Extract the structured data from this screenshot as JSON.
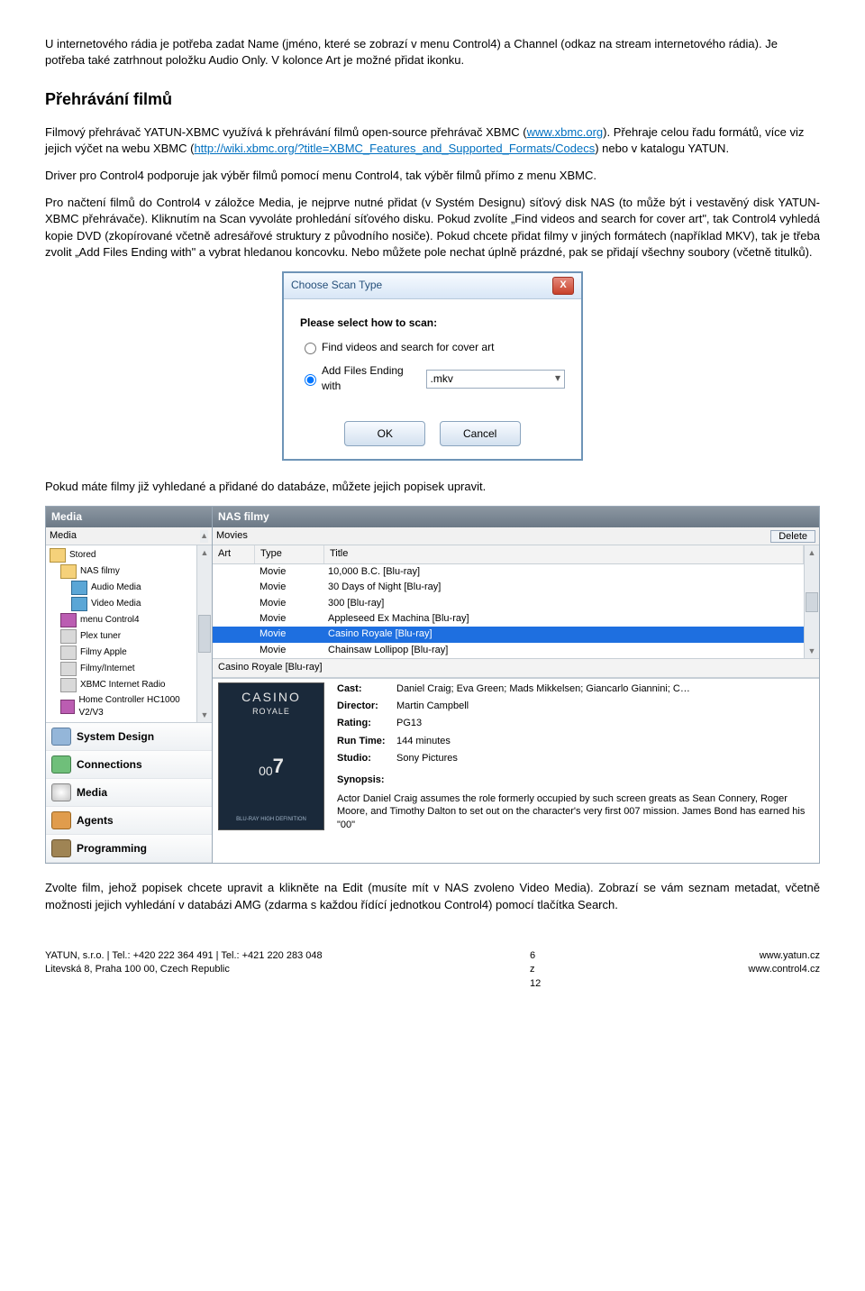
{
  "intro_para": "U internetového rádia je potřeba zadat Name (jméno, které se zobrazí v menu Control4) a Channel (odkaz na stream internetového rádia). Je potřeba také zatrhnout položku Audio Only. V kolonce Art je možné přidat ikonku.",
  "heading": "Přehrávání filmů",
  "para2a": "Filmový přehrávač YATUN-XBMC využívá k přehrávání filmů open-source přehrávač XBMC (",
  "link1": "www.xbmc.org",
  "para2b": "). Přehraje celou řadu formátů, více viz jejich výčet na webu XBMC (",
  "link2": "http://wiki.xbmc.org/?title=XBMC_Features_and_Supported_Formats/Codecs",
  "para2c": ") nebo v katalogu YATUN.",
  "para3": "Driver pro Control4 podporuje jak výběr filmů pomocí menu Control4, tak výběr filmů přímo z menu XBMC.",
  "para4": "Pro načtení filmů do Control4 v záložce Media, je nejprve nutné přidat (v Systém Designu) síťový disk NAS (to může být i vestavěný disk YATUN-XBMC přehrávače). Kliknutím na Scan vyvoláte prohledání síťového disku. Pokud zvolíte „Find videos and search for cover art\", tak Control4 vyhledá kopie DVD (zkopírované včetně adresářové struktury z původního nosiče). Pokud chcete přidat filmy v jiných formátech (například MKV), tak je třeba zvolit „Add Files Ending with\" a vybrat hledanou koncovku. Nebo můžete pole nechat úplně prázdné, pak se přidají všechny soubory (včetně titulků).",
  "dialog": {
    "title": "Choose Scan Type",
    "prompt": "Please select how to scan:",
    "opt1": "Find videos and search for cover art",
    "opt2": "Add Files Ending with",
    "combo_value": ".mkv",
    "ok": "OK",
    "cancel": "Cancel"
  },
  "para5": "Pokud máte filmy již vyhledané a přidané do databáze, můžete jejich popisek upravit.",
  "media": {
    "tree_header": "Media",
    "right_header": "NAS filmy",
    "sub_left": "Media",
    "sub_right": "Movies",
    "delete": "Delete",
    "stored": "Stored",
    "tree_items": [
      "NAS filmy",
      "Audio Media",
      "Video Media",
      "menu Control4",
      "Plex tuner",
      "Filmy Apple",
      "Filmy/Internet",
      "XBMC Internet Radio",
      "Home Controller HC1000 V2/V3"
    ],
    "nav": [
      "System Design",
      "Connections",
      "Media",
      "Agents",
      "Programming"
    ],
    "cols": {
      "art": "Art",
      "type": "Type",
      "title": "Title"
    },
    "rows": [
      {
        "type": "Movie",
        "title": "10,000 B.C. [Blu-ray]"
      },
      {
        "type": "Movie",
        "title": "30 Days of Night [Blu-ray]"
      },
      {
        "type": "Movie",
        "title": "300 [Blu-ray]"
      },
      {
        "type": "Movie",
        "title": "Appleseed Ex Machina [Blu-ray]"
      },
      {
        "type": "Movie",
        "title": "Casino Royale [Blu-ray]",
        "selected": true
      },
      {
        "type": "Movie",
        "title": "Chainsaw Lollipop [Blu-ray]"
      }
    ],
    "detail": {
      "title": "Casino Royale [Blu-ray]",
      "cover_big": "CASINO",
      "cover_sub": "ROYALE",
      "cover_seven": "7",
      "cast_label": "Cast:",
      "cast": "Daniel Craig; Eva Green; Mads Mikkelsen; Giancarlo Giannini; C…",
      "director_label": "Director:",
      "director": "Martin Campbell",
      "rating_label": "Rating:",
      "rating": "PG13",
      "runtime_label": "Run Time:",
      "runtime": "144 minutes",
      "studio_label": "Studio:",
      "studio": "Sony Pictures",
      "synopsis_label": "Synopsis:",
      "synopsis": "Actor Daniel Craig assumes the role formerly occupied by such screen greats as Sean Connery, Roger Moore, and Timothy Dalton to set out on the character's very first 007 mission. James Bond has earned his \"00\""
    }
  },
  "para6": "Zvolte film, jehož popisek chcete upravit a klikněte na Edit (musíte mít v NAS zvoleno Video Media). Zobrazí se vám seznam metadat, včetně možnosti jejich vyhledání v databázi AMG (zdarma s každou řídící jednotkou Control4) pomocí tlačítka Search.",
  "footer": {
    "l1": "YATUN, s.r.o. | Tel.: +420 222 364 491 | Tel.: +421 220 283 048",
    "l2": "Litevská 8, Praha 100 00, Czech Republic",
    "center": "6 z 12",
    "r1": "www.yatun.cz",
    "r2": "www.control4.cz"
  }
}
